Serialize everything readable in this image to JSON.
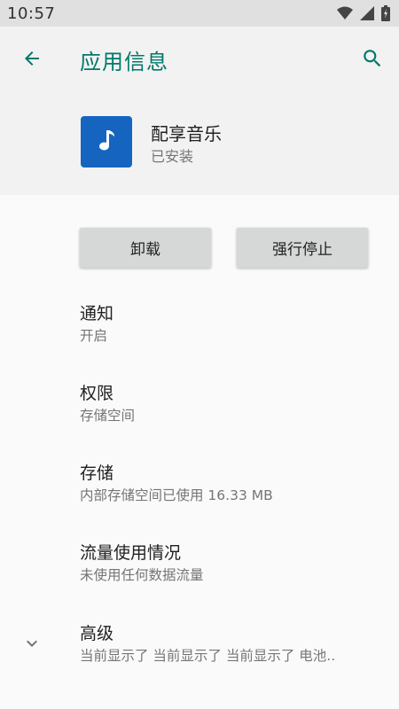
{
  "status_bar": {
    "time": "10:57",
    "icons": [
      "wifi-icon",
      "signal-icon",
      "battery-icon"
    ]
  },
  "toolbar": {
    "title": "应用信息",
    "back_icon": "arrow-back-icon",
    "search_icon": "search-icon"
  },
  "app": {
    "name": "配享音乐",
    "status": "已安装",
    "icon": "music-note-icon",
    "icon_color": "#1565c0"
  },
  "buttons": {
    "uninstall": "卸载",
    "force_stop": "强行停止"
  },
  "preferences": [
    {
      "title": "通知",
      "summary": "开启"
    },
    {
      "title": "权限",
      "summary": "存储空间"
    },
    {
      "title": "存储",
      "summary": "内部存储空间已使用 16.33 MB"
    },
    {
      "title": "流量使用情况",
      "summary": "未使用任何数据流量"
    },
    {
      "title": "高级",
      "summary": "当前显示了 当前显示了 当前显示了 电池..",
      "icon": "chevron-down-icon"
    }
  ],
  "colors": {
    "accent": "#00796b",
    "status_bar_bg": "#e0e0e0",
    "header_bg": "#f2f2f2",
    "button_bg": "#d6d7d7"
  }
}
